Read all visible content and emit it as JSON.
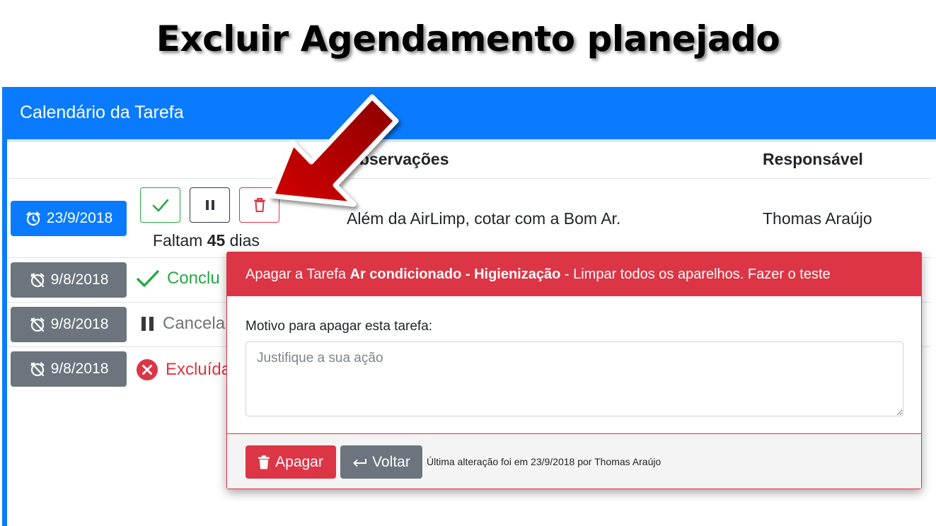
{
  "headline": "Excluir Agendamento planejado",
  "card": {
    "title": "Calendário da Tarefa",
    "columns": {
      "observacoes": "Observações",
      "responsavel": "Responsável"
    }
  },
  "rows": [
    {
      "date": "23/9/2018",
      "remaining_prefix": "Faltam",
      "remaining_days": "45",
      "remaining_suffix": "dias",
      "observation": "Além da AirLimp, cotar com a Bom Ar.",
      "responsible": "Thomas Araújo"
    },
    {
      "date": "9/8/2018",
      "status": "Conclu"
    },
    {
      "date": "9/8/2018",
      "status": "Cancela"
    },
    {
      "date": "9/8/2018",
      "status": "Excluída"
    }
  ],
  "modal": {
    "title_prefix": "Apagar a Tarefa",
    "task_name": "Ar condicionado - Higienização",
    "task_desc": "- Limpar todos os aparelhos. Fazer o teste",
    "label": "Motivo para apagar esta tarefa:",
    "placeholder": "Justifique a sua ação",
    "delete_label": "Apagar",
    "back_label": "Voltar",
    "footer_note": "Última alteração foi em 23/9/2018 por Thomas Araújo"
  },
  "colors": {
    "primary": "#0a7bff",
    "secondary": "#6c757d",
    "danger": "#dc3545",
    "success": "#28a745",
    "arrow": "#c00000"
  },
  "icons": {
    "alarm": "alarm-clock-icon",
    "alarm_off": "alarm-off-icon",
    "check": "check-icon",
    "pause": "pause-icon",
    "trash": "trash-icon",
    "x_circle": "x-circle-icon",
    "back_arrow": "return-arrow-icon",
    "pointer": "big-red-arrow"
  }
}
